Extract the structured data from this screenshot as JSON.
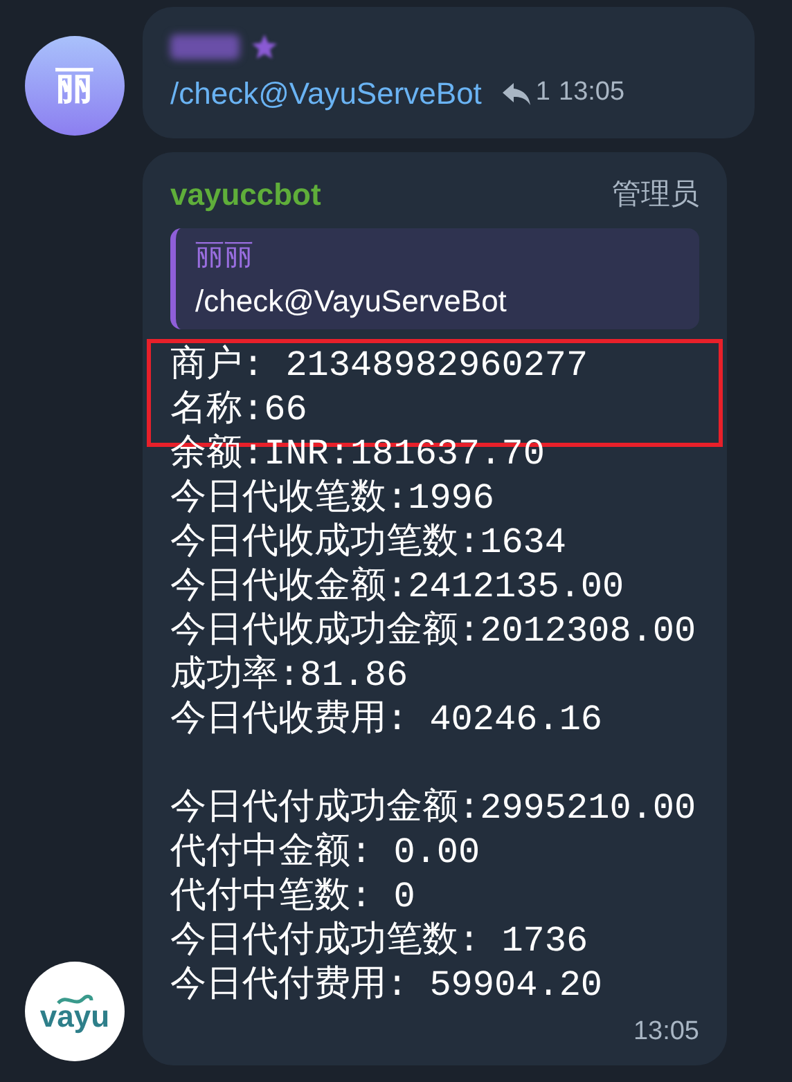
{
  "messages": [
    {
      "avatar": {
        "kind": "letter",
        "text": "丽"
      },
      "command": "/check@VayuServeBot",
      "replies": "1",
      "time": "13:05"
    },
    {
      "avatar": {
        "kind": "logo",
        "text": "vayu"
      },
      "sender": "vayuccbot",
      "role": "管理员",
      "quote": {
        "author": "丽丽",
        "text": "/check@VayuServeBot"
      },
      "sections": [
        [
          {
            "text": "商户: 21348982960277",
            "highlighted": true
          },
          {
            "text": "名称:66",
            "highlighted": true
          },
          {
            "text": "余额:INR:181637.70",
            "highlighted": false
          },
          {
            "text": "今日代收笔数:1996",
            "highlighted": false
          },
          {
            "text": "今日代收成功笔数:1634",
            "highlighted": false
          },
          {
            "text": "今日代收金额:2412135.00",
            "highlighted": false
          },
          {
            "text": "今日代收成功金额:2012308.00",
            "highlighted": false
          },
          {
            "text": "成功率:81.86",
            "highlighted": false
          },
          {
            "text": "今日代收费用: 40246.16",
            "highlighted": false
          }
        ],
        [
          {
            "text": "今日代付成功金额:2995210.00",
            "highlighted": false
          },
          {
            "text": "代付中金额: 0.00",
            "highlighted": false
          },
          {
            "text": "代付中笔数: 0",
            "highlighted": false
          },
          {
            "text": "今日代付成功笔数: 1736",
            "highlighted": false
          },
          {
            "text": "今日代付费用: 59904.20",
            "highlighted": false
          }
        ]
      ],
      "time": "13:05"
    }
  ]
}
